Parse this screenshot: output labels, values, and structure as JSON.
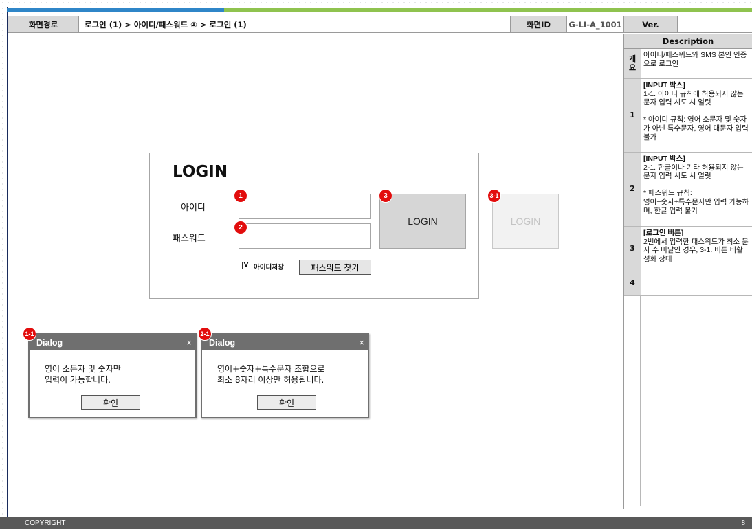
{
  "header": {
    "path_label": "화면경로",
    "path": "로그인 (1) > 아이디/패스워드 ① > 로그인 (1)",
    "id_label": "화면ID",
    "id": "G-LI-A_1001",
    "ver_label": "Ver.",
    "ver": ""
  },
  "description": {
    "title": "Description",
    "rows": [
      {
        "num": "개\n요",
        "title": "",
        "text": "아이디/패스워드와 SMS 본인 인증으로 로그인"
      },
      {
        "num": "1",
        "title": "[INPUT 박스]",
        "text": "1-1. 아이디 규칙에 허용되지 않는 문자 입력 시도 시 얼럿\n\n* 아이디 규칙: 영어 소문자 및 숫자가 아닌 특수문자, 영어 대문자 입력 불가"
      },
      {
        "num": "2",
        "title": "[INPUT 박스]",
        "text": " 2-1. 한글이나 기타 허용되지 않는 문자 입력 시도 시 얼럿\n\n* 패스워드 규칙:\n영어+숫자+특수문자만 입력 가능하며, 한글 입력 불가"
      },
      {
        "num": "3",
        "title": "[로그인 버튼]",
        "text": "2번에서 입력한 패스워드가 최소 문자 수 미달인 경우, 3-1. 버튼 비활성화 상태"
      },
      {
        "num": "4",
        "title": "",
        "text": ""
      }
    ]
  },
  "login": {
    "title": "LOGIN",
    "id_label": "아이디",
    "pw_label": "패스워드",
    "id_value": "",
    "pw_value": "",
    "login_button": "LOGIN",
    "login_button_disabled": "LOGIN",
    "remember_check": "V",
    "remember_label": "아이디저장",
    "find_pw_button": "패스워드 찾기"
  },
  "badges": {
    "b1": "1",
    "b2": "2",
    "b3": "3",
    "b31": "3-1",
    "b11": "1-1",
    "b21": "2-1"
  },
  "dialogs": [
    {
      "title": "Dialog",
      "close": "×",
      "message": "영어 소문자 및 숫자만\n입력이 가능합니다.",
      "ok": "확인"
    },
    {
      "title": "Dialog",
      "close": "×",
      "message": "영어+숫자+특수문자 조합으로\n최소 8자리 이상만 허용됩니다.",
      "ok": "확인"
    }
  ],
  "footer": {
    "copyright": "COPYRIGHT",
    "page": "8"
  },
  "colors": {
    "badge": "#e20d0d",
    "top_blue": "#2f86c8",
    "top_green": "#8fc34f",
    "footer": "#595959"
  }
}
